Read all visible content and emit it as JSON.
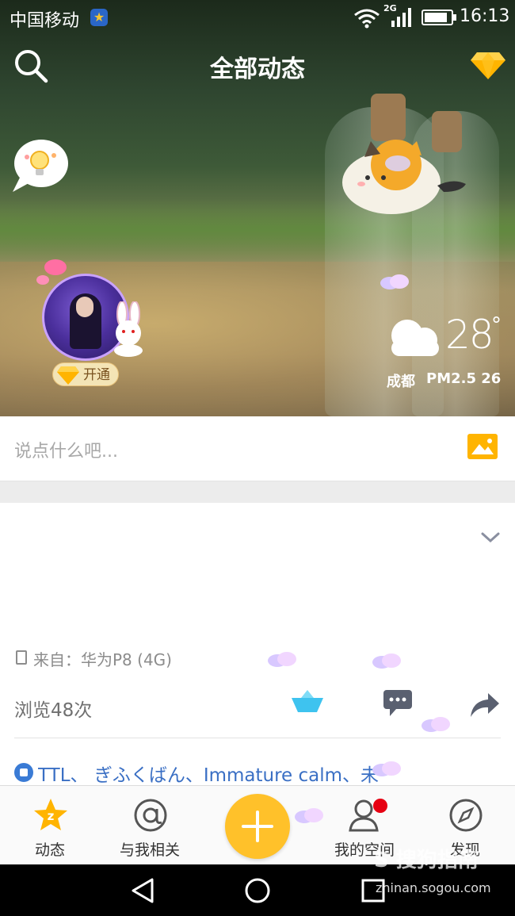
{
  "status_bar": {
    "carrier": "中国移动",
    "network": "2G",
    "time": "16:13"
  },
  "header": {
    "title": "全部动态"
  },
  "profile": {
    "open_vip_label": "开通"
  },
  "weather": {
    "temperature": "28",
    "degree": "°",
    "city": "成都",
    "pm25": "PM2.5  26"
  },
  "compose": {
    "placeholder": "说点什么吧..."
  },
  "post": {
    "device": "来自：华为P8 (4G)",
    "views": "浏览48次",
    "likers": "TTL、          ぎふくばん、Immature calm、未"
  },
  "tabs": [
    {
      "label": "动态"
    },
    {
      "label": "与我相关"
    },
    {
      "label": "我的空间"
    },
    {
      "label": "发现"
    }
  ],
  "watermark": {
    "logo": "S 搜狗指南",
    "url": "zhinan.sogou.com"
  },
  "colors": {
    "accent": "#ffc12a",
    "link": "#3a6fc4",
    "badge": "#e60012"
  }
}
